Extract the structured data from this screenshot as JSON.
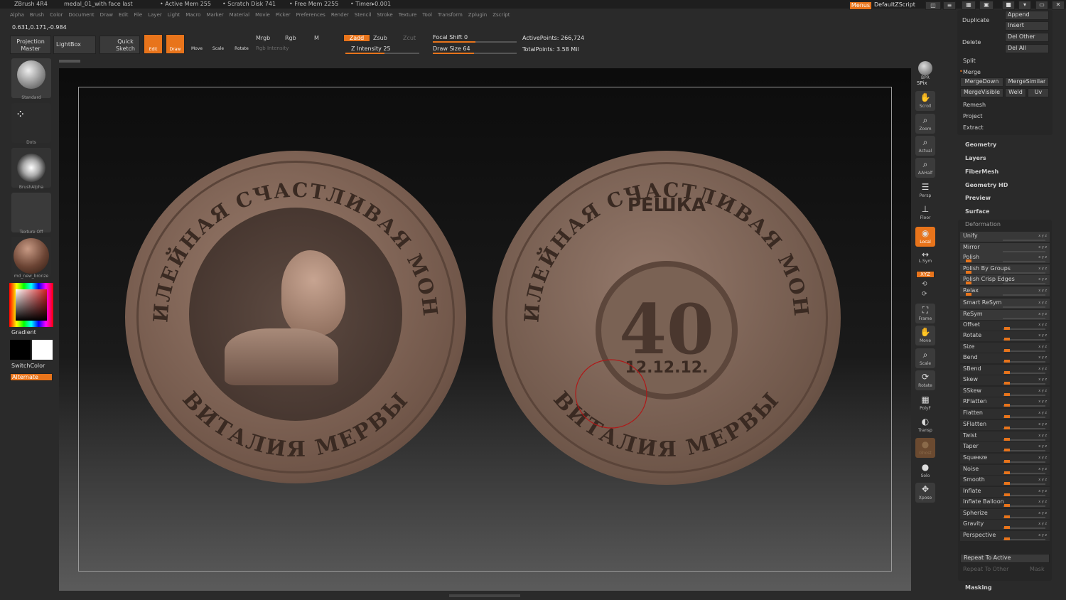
{
  "titlebar": {
    "app": "ZBrush 4R4",
    "doc": "medal_01_with face last",
    "active_mem": "• Active Mem 255",
    "scratch": "• Scratch Disk 741",
    "free_mem": "• Free Mem 2255",
    "timer": "• Timer▸0.001",
    "menus": "Menus",
    "script": "DefaultZScript"
  },
  "coords": "0.631,0.171,-0.984",
  "menu": [
    "Alpha",
    "Brush",
    "Color",
    "Document",
    "Draw",
    "Edit",
    "File",
    "Layer",
    "Light",
    "Macro",
    "Marker",
    "Material",
    "Movie",
    "Picker",
    "Preferences",
    "Render",
    "Stencil",
    "Stroke",
    "Texture",
    "Tool",
    "Transform",
    "Zplugin",
    "Zscript"
  ],
  "toolbar": {
    "projection_master": "Projection Master",
    "lightbox": "LightBox",
    "quick_sketch": "Quick Sketch",
    "edit": "Edit",
    "draw": "Draw",
    "move": "Move",
    "scale": "Scale",
    "rotate": "Rotate",
    "mrgb": "Mrgb",
    "rgb": "Rgb",
    "m": "M",
    "rgb_intensity": "Rgb Intensity",
    "zadd": "Zadd",
    "zsub": "Zsub",
    "zcut": "Zcut",
    "z_intensity": "Z Intensity 25",
    "focal_shift": "Focal Shift 0",
    "draw_size": "Draw Size 64",
    "active_points": "ActivePoints: 266,724",
    "total_points": "TotalPoints: 3.58 Mil"
  },
  "left": {
    "brush": "Standard",
    "stroke": "Dots",
    "alpha": "BrushAlpha",
    "texture": "Texture Off",
    "material": "md_new_bronze",
    "gradient": "Gradient",
    "switchcolor": "SwitchColor",
    "alternate": "Alternate"
  },
  "coin_left": {
    "arc_top": "ЮБИЛЕЙНАЯ СЧАСТЛИВАЯ МОНЕТА",
    "arc_bottom": "ВИТАЛИЯ МЕРВЫ"
  },
  "coin_right": {
    "arc_top": "ЮБИЛЕЙНАЯ СЧАСТЛИВАЯ МОНЕТА",
    "title": "РЕШКА",
    "number": "40",
    "date": "12.12.12.",
    "arc_bottom": "ВИТАЛИЯ МЕРВЫ"
  },
  "shelf": {
    "bpr": "BPR",
    "spix": "SPix",
    "scroll": "Scroll",
    "zoom": "Zoom",
    "actual": "Actual",
    "aahalf": "AAHalf",
    "persp": "Persp",
    "floor": "Floor",
    "local": "Local",
    "lsym": "L.Sym",
    "xyz": "XYZ",
    "frame": "Frame",
    "move": "Move",
    "scale": "Scale",
    "rotate": "Rotate",
    "polyf": "PolyF",
    "transp": "Transp",
    "ghost": "Ghost",
    "solo": "Solo",
    "xpose": "Xpose"
  },
  "subtool": {
    "duplicate": "Duplicate",
    "append": "Append",
    "insert": "Insert",
    "delete": "Delete",
    "del_other": "Del Other",
    "del_all": "Del All",
    "split": "Split",
    "merge": "Merge",
    "merge_down": "MergeDown",
    "merge_similar": "MergeSimilar",
    "merge_visible": "MergeVisible",
    "weld": "Weld",
    "uv": "Uv",
    "remesh": "Remesh",
    "project": "Project",
    "extract": "Extract"
  },
  "sections": [
    "Geometry",
    "Layers",
    "FiberMesh",
    "Geometry HD",
    "Preview",
    "Surface"
  ],
  "deformation": {
    "header": "Deformation",
    "items": [
      {
        "label": "Unify",
        "level": 0
      },
      {
        "label": "Mirror",
        "level": 0
      },
      {
        "label": "Polish",
        "level": 0.05
      },
      {
        "label": "Polish By Groups",
        "level": 0.05
      },
      {
        "label": "Polish Crisp Edges",
        "level": 0.05
      },
      {
        "label": "Relax",
        "level": 0.05
      },
      {
        "label": "Smart ReSym",
        "level": 0
      },
      {
        "label": "ReSym",
        "level": 0
      },
      {
        "label": "Offset",
        "level": 0.5
      },
      {
        "label": "Rotate",
        "level": 0.5
      },
      {
        "label": "Size",
        "level": 0.5
      },
      {
        "label": "Bend",
        "level": 0.5
      },
      {
        "label": "SBend",
        "level": 0.5
      },
      {
        "label": "Skew",
        "level": 0.5
      },
      {
        "label": "SSkew",
        "level": 0.5
      },
      {
        "label": "RFlatten",
        "level": 0.5
      },
      {
        "label": "Flatten",
        "level": 0.5
      },
      {
        "label": "SFlatten",
        "level": 0.5
      },
      {
        "label": "Twist",
        "level": 0.5
      },
      {
        "label": "Taper",
        "level": 0.5
      },
      {
        "label": "Squeeze",
        "level": 0.5
      },
      {
        "label": "Noise",
        "level": 0.5
      },
      {
        "label": "Smooth",
        "level": 0.5
      },
      {
        "label": "Inflate",
        "level": 0.5
      },
      {
        "label": "Inflate Balloon",
        "level": 0.5
      },
      {
        "label": "Spherize",
        "level": 0.5
      },
      {
        "label": "Gravity",
        "level": 0.5
      },
      {
        "label": "Perspective",
        "level": 0.5
      }
    ],
    "repeat_active": "Repeat To Active",
    "repeat_other": "Repeat To Other",
    "mask": "Mask"
  },
  "masking": "Masking",
  "colors": {
    "accent": "#e8741b",
    "bronze": "#8a6e5e",
    "bg": "#2a2a2a"
  }
}
